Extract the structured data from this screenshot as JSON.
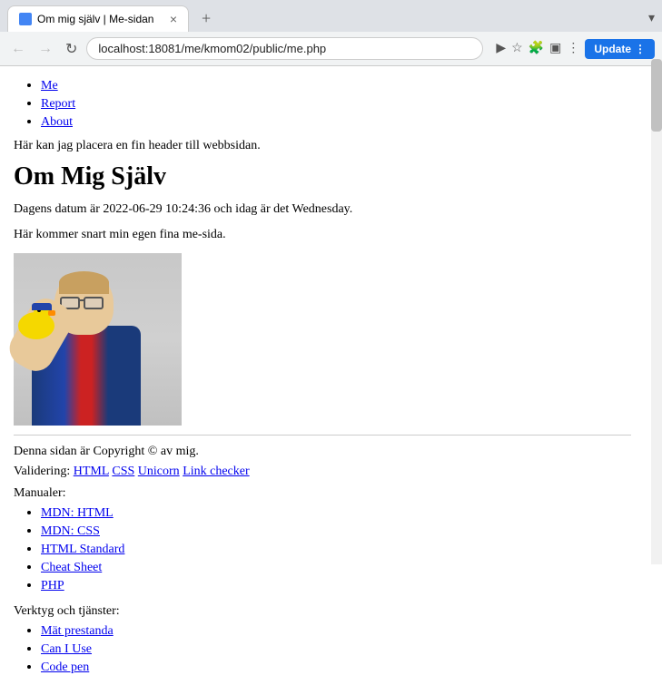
{
  "browser": {
    "tab_title": "Om mig själv | Me-sidan",
    "tab_close": "×",
    "new_tab": "+",
    "address": "localhost:18081/me/kmom02/public/me.php",
    "back_btn": "←",
    "forward_btn": "→",
    "reload_btn": "↻",
    "home_btn": "⌂",
    "update_label": "Update",
    "arrow_dropdown": "⋮"
  },
  "nav": {
    "items": [
      {
        "label": "Me",
        "href": "#"
      },
      {
        "label": "Report",
        "href": "#"
      },
      {
        "label": "About",
        "href": "#"
      }
    ]
  },
  "page": {
    "header_text": "Här kan jag placera en fin header till webbsidan.",
    "title": "Om Mig Själv",
    "date_text": "Dagens datum är 2022-06-29 10:24:36 och idag är det Wednesday.",
    "coming_text": "Här kommer snart min egen fina me-sida."
  },
  "footer": {
    "copyright": "Denna sidan är Copyright © av mig.",
    "validation_label": "Validering:",
    "validation_links": [
      {
        "label": "HTML",
        "href": "#"
      },
      {
        "label": "CSS",
        "href": "#"
      },
      {
        "label": "Unicorn",
        "href": "#"
      },
      {
        "label": "Link checker",
        "href": "#"
      }
    ],
    "manuals_label": "Manualer:",
    "manual_links": [
      {
        "label": "MDN: HTML",
        "href": "#"
      },
      {
        "label": "MDN: CSS",
        "href": "#"
      },
      {
        "label": "HTML Standard",
        "href": "#"
      },
      {
        "label": "Cheat Sheet",
        "href": "#"
      },
      {
        "label": "PHP",
        "href": "#"
      }
    ],
    "tools_label": "Verktyg och tjänster:",
    "tool_links": [
      {
        "label": "Mät prestanda",
        "href": "#"
      },
      {
        "label": "Can I Use",
        "href": "#"
      },
      {
        "label": "Code pen",
        "href": "#"
      }
    ]
  }
}
